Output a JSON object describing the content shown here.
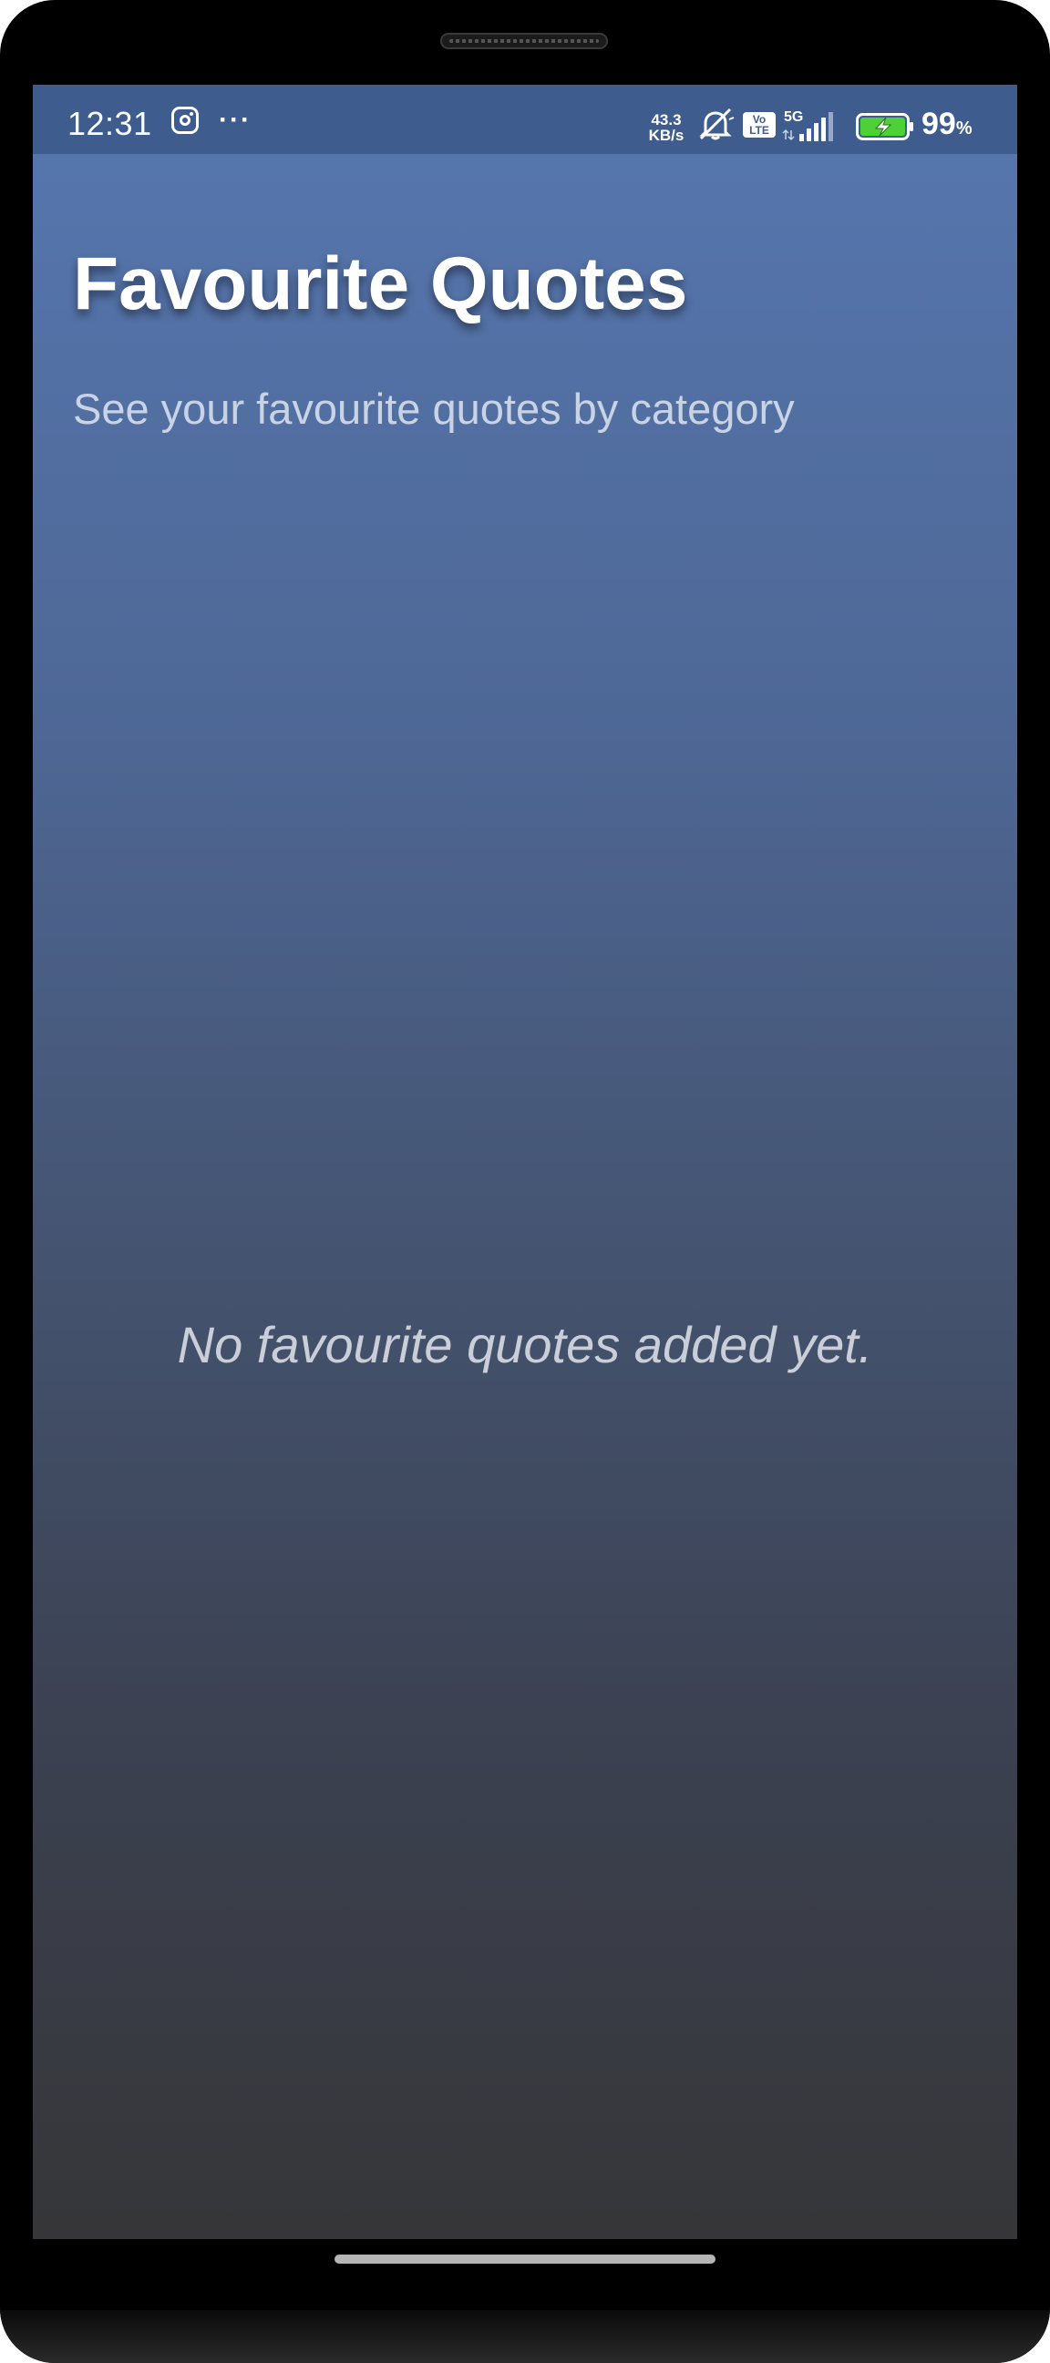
{
  "status_bar": {
    "time": "12:31",
    "network_speed_value": "43.3",
    "network_speed_unit": "KB/s",
    "volte_top": "Vo",
    "volte_bottom": "LTE",
    "network_type": "5G",
    "battery_percent": "99",
    "battery_percent_sign": "%",
    "icons": [
      "instagram-icon",
      "more-dots-icon",
      "mute-icon",
      "volte-icon",
      "signal-icon",
      "battery-charging-icon"
    ]
  },
  "header": {
    "title": "Favourite Quotes",
    "subtitle": "See your favourite quotes by category"
  },
  "main": {
    "empty_message": "No favourite quotes added yet."
  },
  "colors": {
    "status_bar_bg": "#3f5c8e",
    "gradient_top": "#5677b0",
    "gradient_bottom": "#363638",
    "battery_fill": "#4cd137"
  }
}
